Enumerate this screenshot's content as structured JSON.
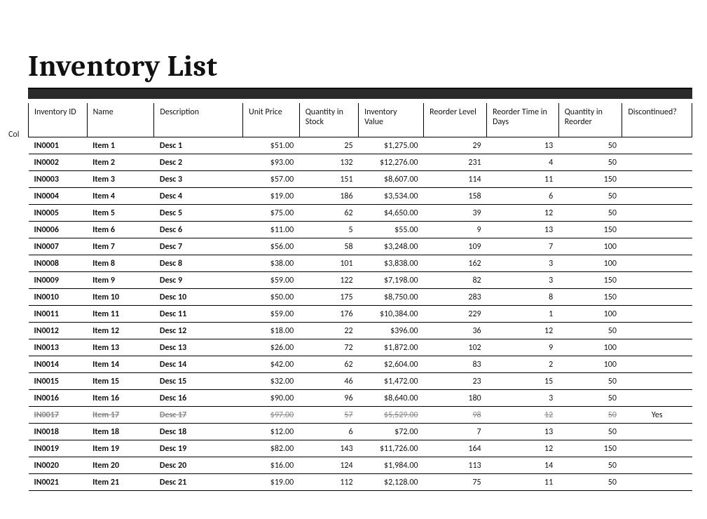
{
  "title": "Inventory List",
  "side_label": "Col",
  "columns": {
    "id": "Inventory ID",
    "name": "Name",
    "desc": "Description",
    "up": "Unit Price",
    "qty": "Quantity in Stock",
    "val": "Inventory Value",
    "rl": "Reorder Level",
    "rt": "Reorder Time in Days",
    "qr": "Quantity in Reorder",
    "dc": "Discontinued?"
  },
  "rows": [
    {
      "id": "IN0001",
      "name": "Item 1",
      "desc": "Desc 1",
      "up": "$51.00",
      "qty": "25",
      "val": "$1,275.00",
      "rl": "29",
      "rt": "13",
      "qr": "50",
      "dc": "",
      "discontinued": false
    },
    {
      "id": "IN0002",
      "name": "Item 2",
      "desc": "Desc 2",
      "up": "$93.00",
      "qty": "132",
      "val": "$12,276.00",
      "rl": "231",
      "rt": "4",
      "qr": "50",
      "dc": "",
      "discontinued": false
    },
    {
      "id": "IN0003",
      "name": "Item 3",
      "desc": "Desc 3",
      "up": "$57.00",
      "qty": "151",
      "val": "$8,607.00",
      "rl": "114",
      "rt": "11",
      "qr": "150",
      "dc": "",
      "discontinued": false
    },
    {
      "id": "IN0004",
      "name": "Item 4",
      "desc": "Desc 4",
      "up": "$19.00",
      "qty": "186",
      "val": "$3,534.00",
      "rl": "158",
      "rt": "6",
      "qr": "50",
      "dc": "",
      "discontinued": false
    },
    {
      "id": "IN0005",
      "name": "Item 5",
      "desc": "Desc 5",
      "up": "$75.00",
      "qty": "62",
      "val": "$4,650.00",
      "rl": "39",
      "rt": "12",
      "qr": "50",
      "dc": "",
      "discontinued": false
    },
    {
      "id": "IN0006",
      "name": "Item 6",
      "desc": "Desc 6",
      "up": "$11.00",
      "qty": "5",
      "val": "$55.00",
      "rl": "9",
      "rt": "13",
      "qr": "150",
      "dc": "",
      "discontinued": false
    },
    {
      "id": "IN0007",
      "name": "Item 7",
      "desc": "Desc 7",
      "up": "$56.00",
      "qty": "58",
      "val": "$3,248.00",
      "rl": "109",
      "rt": "7",
      "qr": "100",
      "dc": "",
      "discontinued": false
    },
    {
      "id": "IN0008",
      "name": "Item 8",
      "desc": "Desc 8",
      "up": "$38.00",
      "qty": "101",
      "val": "$3,838.00",
      "rl": "162",
      "rt": "3",
      "qr": "100",
      "dc": "",
      "discontinued": false
    },
    {
      "id": "IN0009",
      "name": "Item 9",
      "desc": "Desc 9",
      "up": "$59.00",
      "qty": "122",
      "val": "$7,198.00",
      "rl": "82",
      "rt": "3",
      "qr": "150",
      "dc": "",
      "discontinued": false
    },
    {
      "id": "IN0010",
      "name": "Item 10",
      "desc": "Desc 10",
      "up": "$50.00",
      "qty": "175",
      "val": "$8,750.00",
      "rl": "283",
      "rt": "8",
      "qr": "150",
      "dc": "",
      "discontinued": false
    },
    {
      "id": "IN0011",
      "name": "Item 11",
      "desc": "Desc 11",
      "up": "$59.00",
      "qty": "176",
      "val": "$10,384.00",
      "rl": "229",
      "rt": "1",
      "qr": "100",
      "dc": "",
      "discontinued": false
    },
    {
      "id": "IN0012",
      "name": "Item 12",
      "desc": "Desc 12",
      "up": "$18.00",
      "qty": "22",
      "val": "$396.00",
      "rl": "36",
      "rt": "12",
      "qr": "50",
      "dc": "",
      "discontinued": false
    },
    {
      "id": "IN0013",
      "name": "Item 13",
      "desc": "Desc 13",
      "up": "$26.00",
      "qty": "72",
      "val": "$1,872.00",
      "rl": "102",
      "rt": "9",
      "qr": "100",
      "dc": "",
      "discontinued": false
    },
    {
      "id": "IN0014",
      "name": "Item 14",
      "desc": "Desc 14",
      "up": "$42.00",
      "qty": "62",
      "val": "$2,604.00",
      "rl": "83",
      "rt": "2",
      "qr": "100",
      "dc": "",
      "discontinued": false
    },
    {
      "id": "IN0015",
      "name": "Item 15",
      "desc": "Desc 15",
      "up": "$32.00",
      "qty": "46",
      "val": "$1,472.00",
      "rl": "23",
      "rt": "15",
      "qr": "50",
      "dc": "",
      "discontinued": false
    },
    {
      "id": "IN0016",
      "name": "Item 16",
      "desc": "Desc 16",
      "up": "$90.00",
      "qty": "96",
      "val": "$8,640.00",
      "rl": "180",
      "rt": "3",
      "qr": "50",
      "dc": "",
      "discontinued": false
    },
    {
      "id": "IN0017",
      "name": "Item 17",
      "desc": "Desc 17",
      "up": "$97.00",
      "qty": "57",
      "val": "$5,529.00",
      "rl": "98",
      "rt": "12",
      "qr": "50",
      "dc": "Yes",
      "discontinued": true
    },
    {
      "id": "IN0018",
      "name": "Item 18",
      "desc": "Desc 18",
      "up": "$12.00",
      "qty": "6",
      "val": "$72.00",
      "rl": "7",
      "rt": "13",
      "qr": "50",
      "dc": "",
      "discontinued": false
    },
    {
      "id": "IN0019",
      "name": "Item 19",
      "desc": "Desc 19",
      "up": "$82.00",
      "qty": "143",
      "val": "$11,726.00",
      "rl": "164",
      "rt": "12",
      "qr": "150",
      "dc": "",
      "discontinued": false
    },
    {
      "id": "IN0020",
      "name": "Item 20",
      "desc": "Desc 20",
      "up": "$16.00",
      "qty": "124",
      "val": "$1,984.00",
      "rl": "113",
      "rt": "14",
      "qr": "50",
      "dc": "",
      "discontinued": false
    },
    {
      "id": "IN0021",
      "name": "Item 21",
      "desc": "Desc 21",
      "up": "$19.00",
      "qty": "112",
      "val": "$2,128.00",
      "rl": "75",
      "rt": "11",
      "qr": "50",
      "dc": "",
      "discontinued": false
    }
  ]
}
